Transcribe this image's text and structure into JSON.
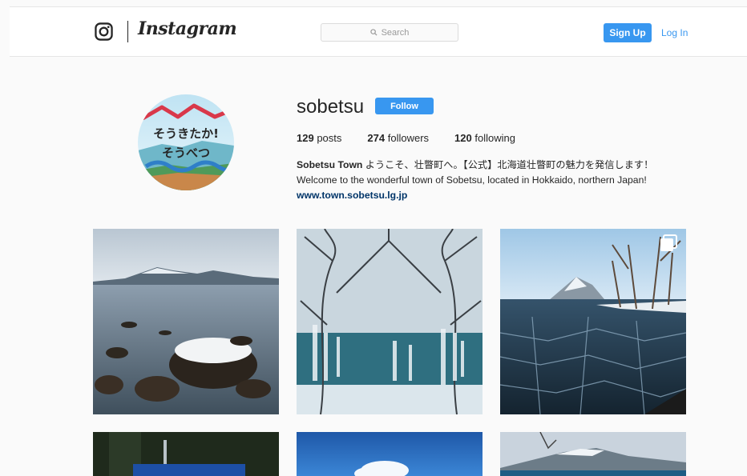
{
  "header": {
    "wordmark": "Instagram",
    "search_placeholder": "Search",
    "signup_label": "Sign Up",
    "login_label": "Log In"
  },
  "profile": {
    "avatar_text_line1": "そうきたか!",
    "avatar_text_line2": "そうべつ",
    "username": "sobetsu",
    "follow_label": "Follow",
    "stats": [
      {
        "count": "129",
        "label": "posts"
      },
      {
        "count": "274",
        "label": "followers"
      },
      {
        "count": "120",
        "label": "following"
      }
    ],
    "full_name": "Sobetsu Town",
    "bio_line1": "ようこそ、壮瞥町へ。【公式】北海道壮瞥町の魅力を発信します！",
    "bio_line2": "Welcome to the wonderful town of Sobetsu, located in Hokkaido, northern Japan!",
    "website": "www.town.sobetsu.lg.jp"
  },
  "colors": {
    "accent": "#3897f0",
    "link": "#003569",
    "text": "#262626",
    "background": "#fafafa",
    "border": "#e6e6e6"
  },
  "posts": [
    {
      "index": 1,
      "subject": "lake with snowy rocks",
      "multi": false
    },
    {
      "index": 2,
      "subject": "frozen trees over lake",
      "multi": false
    },
    {
      "index": 3,
      "subject": "cracked ice lake shore",
      "multi": true
    },
    {
      "index": 4,
      "subject": "dark forest sign",
      "multi": false
    },
    {
      "index": 5,
      "subject": "blue sky clouds",
      "multi": false
    },
    {
      "index": 6,
      "subject": "lake island with snow",
      "multi": false
    }
  ]
}
